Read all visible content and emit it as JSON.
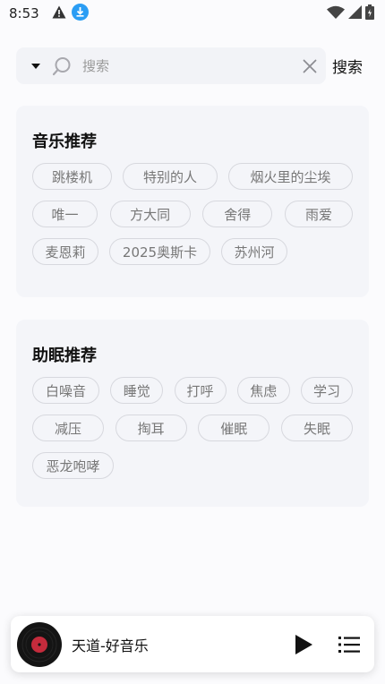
{
  "status_bar": {
    "time": "8:53",
    "left_icons": [
      "alert-triangle-icon",
      "download-badge-icon"
    ],
    "right_icons": [
      "wifi-icon",
      "cell-signal-icon",
      "battery-icon"
    ]
  },
  "search": {
    "dropdown_icon": "caret-down-icon",
    "placeholder": "搜索",
    "value": "",
    "clear_icon": "close-icon",
    "action_label": "搜索"
  },
  "music_section": {
    "title": "音乐推荐",
    "tags": [
      [
        "跳楼机",
        "特别的人",
        "烟火里的尘埃"
      ],
      [
        "唯一",
        "方大同",
        "舍得",
        "雨爱"
      ],
      [
        "麦恩莉",
        "2025奥斯卡",
        "苏州河"
      ]
    ]
  },
  "sleep_section": {
    "title": "助眠推荐",
    "tags": [
      [
        "白噪音",
        "睡觉",
        "打呼",
        "焦虑",
        "学习"
      ],
      [
        "减压",
        "掏耳",
        "催眠",
        "失眠"
      ],
      [
        "恶龙咆哮"
      ]
    ]
  },
  "player": {
    "title": "天道-好音乐",
    "disc_icon": "vinyl-disc-icon",
    "play_icon": "play-icon",
    "playlist_icon": "playlist-icon",
    "accent": "#c42b3c"
  }
}
